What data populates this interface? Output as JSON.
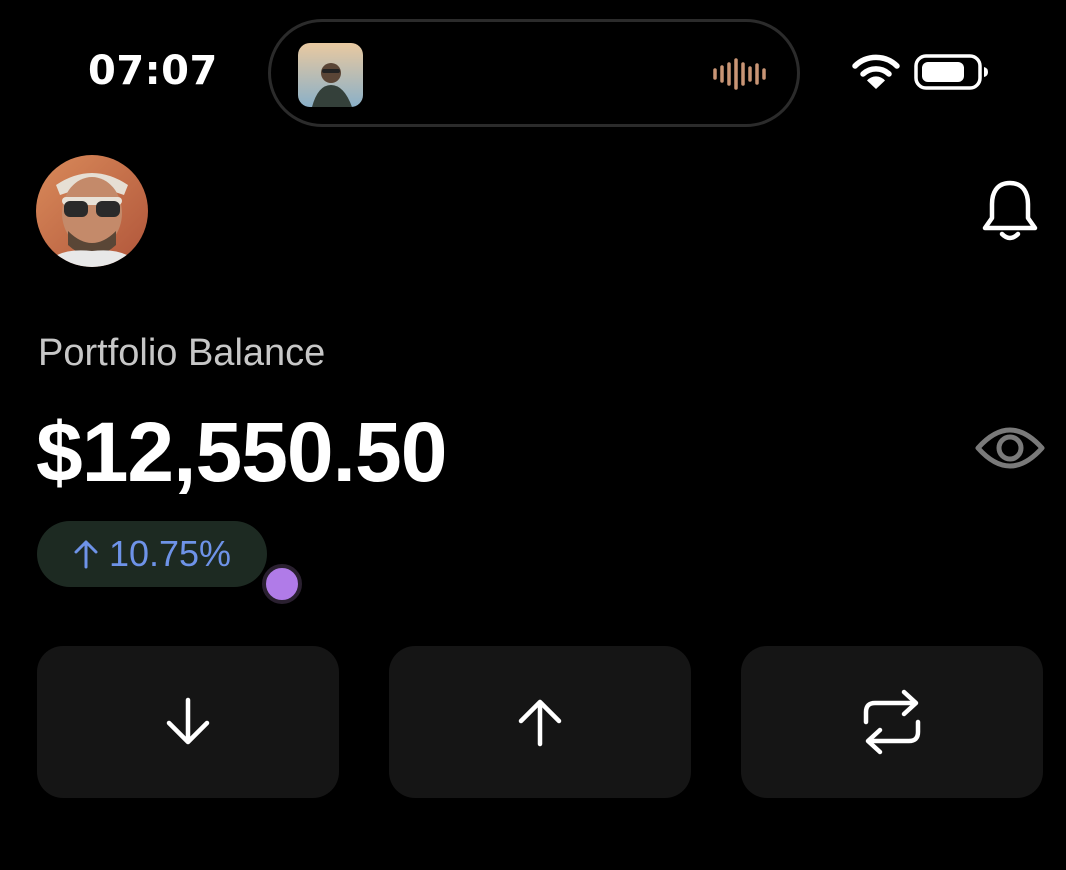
{
  "status_bar": {
    "time": "07:07",
    "battery_level": 0.8
  },
  "portfolio": {
    "label": "Portfolio Balance",
    "amount": "$12,550.50",
    "change": "10.75%",
    "change_direction": "up"
  },
  "actions": [
    {
      "icon": "arrow-down-icon"
    },
    {
      "icon": "arrow-up-icon"
    },
    {
      "icon": "swap-icon"
    }
  ],
  "colors": {
    "background": "#000000",
    "button_bg": "#151515",
    "badge_bg": "#1d2a22",
    "badge_text": "#6e93e8",
    "touch_indicator": "#b07be8"
  }
}
